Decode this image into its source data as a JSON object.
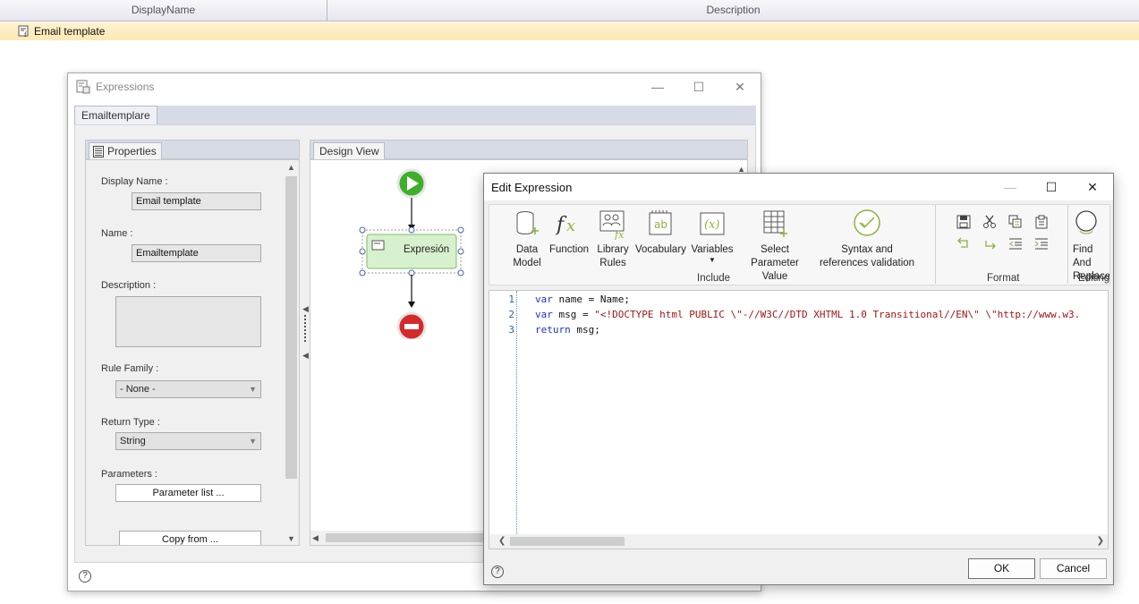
{
  "grid": {
    "columns": [
      "DisplayName",
      "Description"
    ],
    "row_label": "Email template"
  },
  "expressions_window": {
    "title": "Expressions",
    "tab": "Emailtemplare",
    "properties": {
      "tab": "Properties",
      "display_name_label": "Display Name :",
      "display_name_value": "Email template",
      "name_label": "Name :",
      "name_value": "Emailtemplate",
      "description_label": "Description :",
      "rule_family_label": "Rule Family :",
      "rule_family_value": "- None -",
      "return_type_label": "Return Type :",
      "return_type_value": "String",
      "parameters_label": "Parameters :",
      "parameter_list_button": "Parameter list ...",
      "copy_from_button": "Copy from ..."
    },
    "design_view": {
      "tab": "Design View",
      "node_label": "Expresión"
    },
    "help": "?"
  },
  "edit_expression": {
    "title": "Edit Expression",
    "ribbon": {
      "data_model": "Data Model",
      "function": "Function",
      "library_rules": "Library Rules",
      "vocabulary": "Vocabulary",
      "variables": "Variables",
      "select_parameter_value": "Select Parameter Value",
      "syntax_validation": "Syntax and references validation",
      "include_group": "Include",
      "format_group": "Format",
      "find_replace": "Find And Replace",
      "editing_group": "Editing"
    },
    "code_lines": [
      {
        "num": "1",
        "kw": "var",
        "text": " name = Name;"
      },
      {
        "num": "2",
        "kw": "var",
        "text": " msg = ",
        "str": "\"<!DOCTYPE html PUBLIC \\\"-//W3C//DTD XHTML 1.0 Transitional//EN\\\" \\\"http://www.w3."
      },
      {
        "num": "3",
        "kw": "return",
        "text": " msg;"
      }
    ],
    "ok_button": "OK",
    "cancel_button": "Cancel",
    "help": "?"
  },
  "colors": {
    "accent_green": "#3fae2a",
    "stop_red": "#d42a2a",
    "keyword_blue": "#1f30d4",
    "string_red": "#a21515",
    "row_highlight": "#fde9b5"
  }
}
